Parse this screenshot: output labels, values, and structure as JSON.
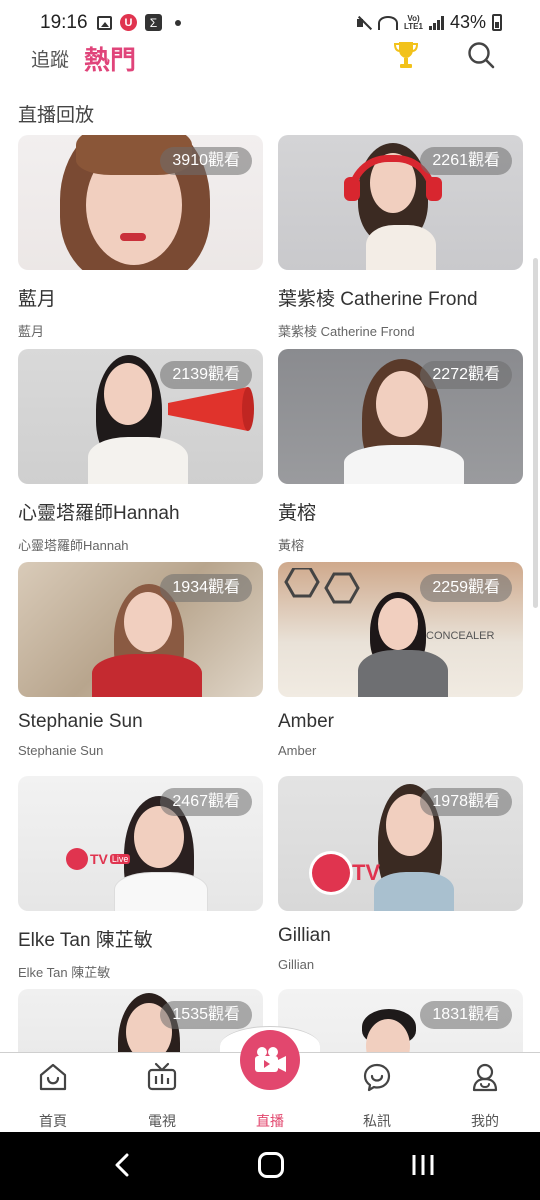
{
  "status_bar": {
    "time": "19:16",
    "battery": "43%",
    "volte_top": "Vo)",
    "volte_bottom": "LTE1"
  },
  "header": {
    "tab_follow": "追蹤",
    "tab_hot": "熱門",
    "accent_color": "#e0447a"
  },
  "section": {
    "title": "直播回放"
  },
  "cards": [
    {
      "title": "藍月",
      "subtitle": "藍月",
      "views": "3910觀看"
    },
    {
      "title": "葉紫棱 Catherine Frond",
      "subtitle": "葉紫棱 Catherine Frond",
      "views": "2261觀看"
    },
    {
      "title": "心靈塔羅師Hannah",
      "subtitle": "心靈塔羅師Hannah",
      "views": "2139觀看"
    },
    {
      "title": "黃榕",
      "subtitle": "黃榕",
      "views": "2272觀看"
    },
    {
      "title": "Stephanie Sun",
      "subtitle": "Stephanie Sun",
      "views": "1934觀看"
    },
    {
      "title": "Amber",
      "subtitle": "Amber",
      "views": "2259觀看"
    },
    {
      "title": "Elke Tan 陳芷敏",
      "subtitle": "Elke Tan 陳芷敏",
      "views": "2467觀看"
    },
    {
      "title": "Gillian",
      "subtitle": "Gillian",
      "views": "1978觀看"
    },
    {
      "title": "",
      "subtitle": "",
      "views": "1535觀看"
    },
    {
      "title": "",
      "subtitle": "",
      "views": "1831觀看"
    }
  ],
  "bottom_nav": {
    "items": [
      {
        "label": "首頁",
        "icon": "home-icon"
      },
      {
        "label": "電視",
        "icon": "tv-icon"
      },
      {
        "label": "直播",
        "icon": "live-camera-icon"
      },
      {
        "label": "私訊",
        "icon": "message-icon"
      },
      {
        "label": "我的",
        "icon": "profile-icon"
      }
    ],
    "active_color": "#e2476e"
  },
  "thumb_logos": {
    "utv_live": "TV",
    "live_tag": "Live",
    "concealer": "CONCEALER"
  }
}
